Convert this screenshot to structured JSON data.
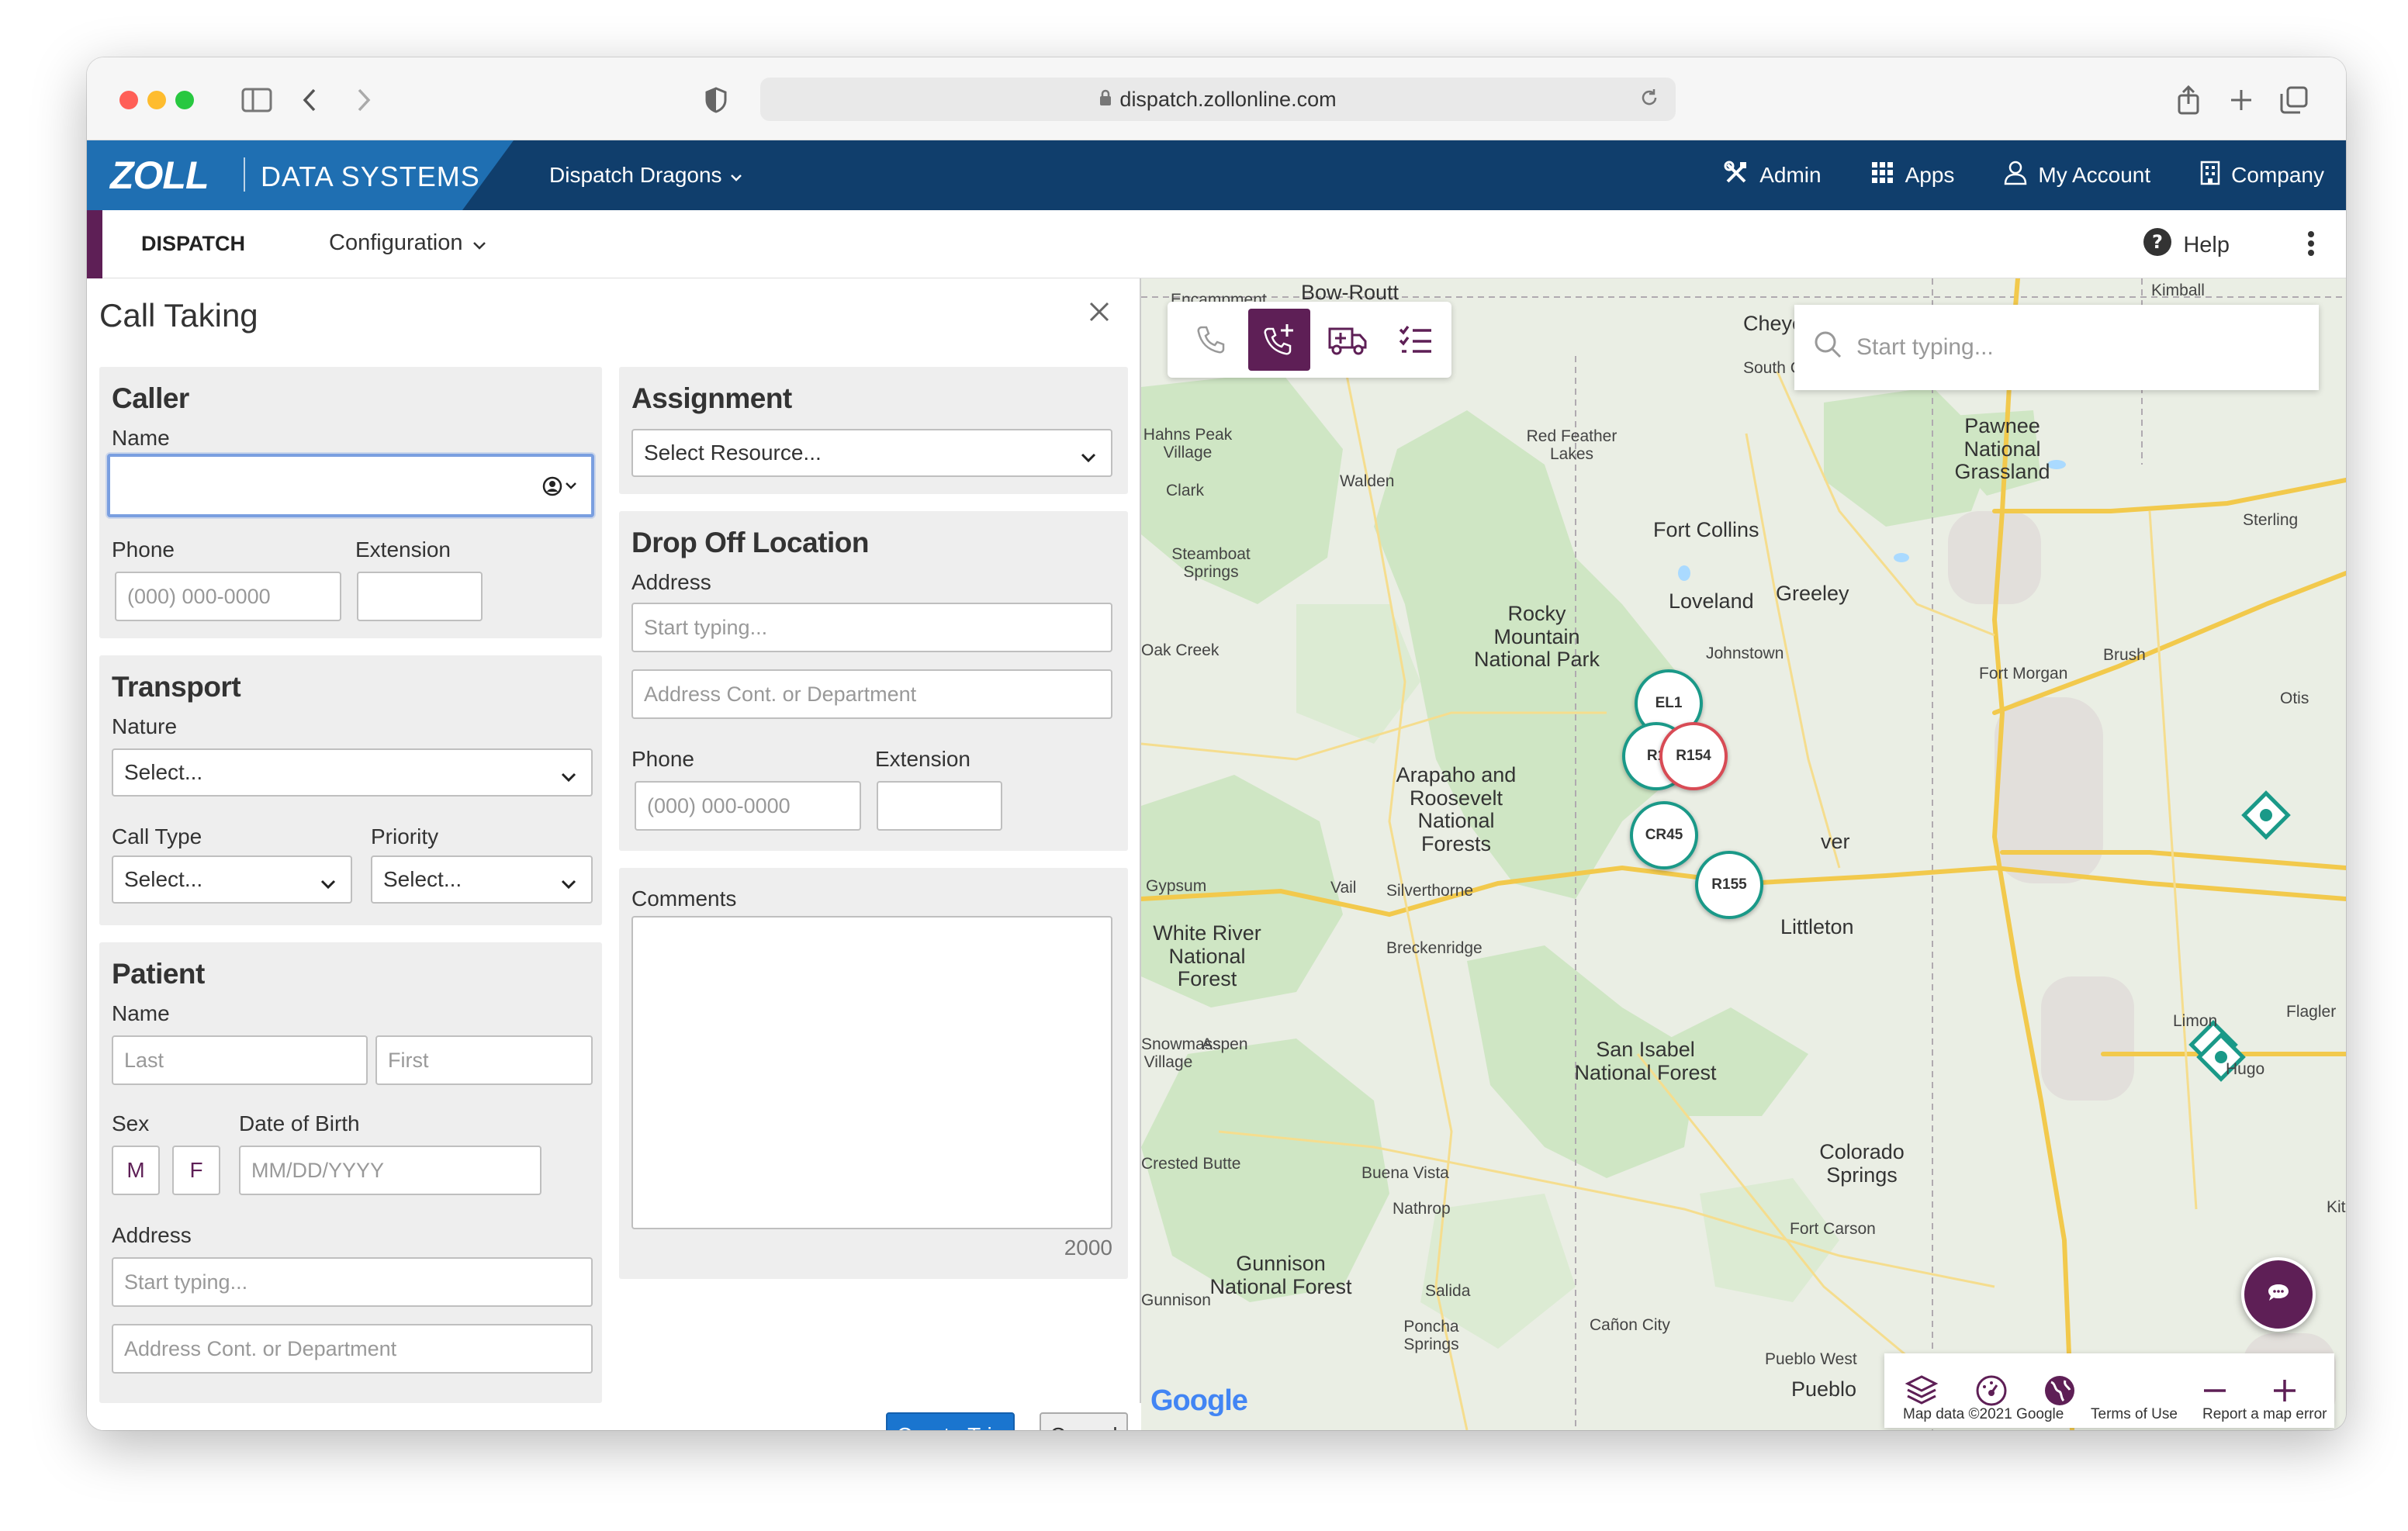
{
  "browser": {
    "url": "dispatch.zollonline.com"
  },
  "topbar": {
    "brand_logo": "ZOLL",
    "brand_name": "DATA SYSTEMS",
    "org_name": "Dispatch Dragons",
    "nav": [
      {
        "label": "Admin",
        "icon": "tools-icon"
      },
      {
        "label": "Apps",
        "icon": "apps-grid-icon"
      },
      {
        "label": "My Account",
        "icon": "user-icon"
      },
      {
        "label": "Company",
        "icon": "building-icon"
      }
    ]
  },
  "subnav": {
    "dispatch": "DISPATCH",
    "configuration": "Configuration",
    "help": "Help"
  },
  "panel": {
    "title": "Call Taking",
    "caller": {
      "heading": "Caller",
      "name_label": "Name",
      "name_value": "",
      "phone_label": "Phone",
      "phone_placeholder": "(000) 000-0000",
      "extension_label": "Extension"
    },
    "transport": {
      "heading": "Transport",
      "nature_label": "Nature",
      "nature_value": "Select...",
      "call_type_label": "Call Type",
      "call_type_value": "Select...",
      "priority_label": "Priority",
      "priority_value": "Select..."
    },
    "patient": {
      "heading": "Patient",
      "name_label": "Name",
      "last_placeholder": "Last",
      "first_placeholder": "First",
      "sex_label": "Sex",
      "sex_m": "M",
      "sex_f": "F",
      "dob_label": "Date of Birth",
      "dob_placeholder": "MM/DD/YYYY",
      "address_label": "Address",
      "address_placeholder": "Start typing...",
      "address2_placeholder": "Address Cont. or Department"
    },
    "assignment": {
      "heading": "Assignment",
      "resource_value": "Select Resource..."
    },
    "dropoff": {
      "heading": "Drop Off Location",
      "address_label": "Address",
      "address_placeholder": "Start typing...",
      "address2_placeholder": "Address  Cont. or Department",
      "phone_label": "Phone",
      "phone_placeholder": "(000) 000-0000",
      "extension_label": "Extension"
    },
    "comments": {
      "label": "Comments",
      "char_count": "2000"
    },
    "buttons": {
      "create": "Create Trip",
      "cancel": "Cancel"
    }
  },
  "map": {
    "search_placeholder": "Start typing...",
    "units": [
      "EL1",
      "R1",
      "R154",
      "CR45",
      "R155"
    ],
    "places": {
      "bow_routt": "Bow-Routt",
      "encampment": "Encampment",
      "cheyenne": "Cheye",
      "south_c": "South C",
      "kimball": "Kimball",
      "pawnee": "Pawnee National Grassland",
      "hahns_peak": "Hahns Peak Village",
      "walden": "Walden",
      "clark": "Clark",
      "red_feather": "Red Feather Lakes",
      "sterling": "Sterling",
      "steamboat": "Steamboat Springs",
      "fort_collins": "Fort Collins",
      "loveland": "Loveland",
      "greeley": "Greeley",
      "johnstown": "Johnstown",
      "rocky_mountain": "Rocky Mountain National Park",
      "oak_creek": "Oak Creek",
      "brush": "Brush",
      "fort_morgan": "Fort Morgan",
      "otis": "Otis",
      "arapaho": "Arapaho and Roosevelt National Forests",
      "denver": "ver",
      "gypsum": "Gypsum",
      "vail": "Vail",
      "silverthorne": "Silverthorne",
      "white_river": "White River National Forest",
      "breckenridge": "Breckenridge",
      "littleton": "Littleton",
      "aspen": "Aspen",
      "snowmass": "Snowmass Village",
      "san_isabel": "San Isabel National Forest",
      "limon": "Limon",
      "flagler": "Flagler",
      "hugo": "Hugo",
      "colorado_springs": "Colorado Springs",
      "crested_butte": "Crested Butte",
      "buena_vista": "Buena Vista",
      "nathrop": "Nathrop",
      "fort_carson": "Fort Carson",
      "gunnison": "Gunnison National Forest",
      "salida": "Salida",
      "poncha": "Poncha Springs",
      "canon_city": "Cañon City",
      "pueblo_west": "Pueblo West",
      "pueblo": "Pueblo",
      "gunnison_town": "Gunnison",
      "kit": "Kit"
    },
    "attribution": {
      "data": "Map data ©2021 Google",
      "terms": "Terms of Use",
      "report": "Report a map error",
      "google": "Google"
    }
  },
  "colors": {
    "brand_dark": "#103e6c",
    "brand_light": "#1f6fb2",
    "accent": "#5e1f56",
    "unit_border": "#1a9988",
    "alert": "#d84b55"
  }
}
